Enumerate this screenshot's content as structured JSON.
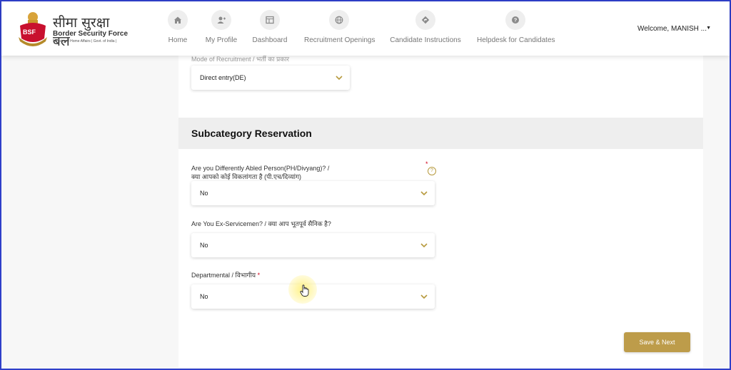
{
  "logo": {
    "hindi": "सीमा सुरक्षा बल",
    "english": "Border Security Force",
    "ministry": "Ministry of Home Affairs | Govt. of India |",
    "badge": "BSF"
  },
  "nav": [
    {
      "label": "Home",
      "icon": "home-icon"
    },
    {
      "label": "My Profile",
      "icon": "user-add-icon"
    },
    {
      "label": "Dashboard",
      "icon": "dashboard-icon"
    },
    {
      "label": "Recruitment Openings",
      "icon": "globe-icon"
    },
    {
      "label": "Candidate Instructions",
      "icon": "directions-icon"
    },
    {
      "label": "Helpdesk for Candidates",
      "icon": "help-icon"
    }
  ],
  "user": {
    "welcome": "Welcome, MANISH ..."
  },
  "form": {
    "mode_label_cut": "Mode of Recruitment / भर्ती का प्रकार",
    "mode_value": "Direct entry(DE)",
    "section_title": "Subcategory Reservation",
    "q1_label_en": "Are you Differently Abled Person(PH/Divyang)? /",
    "q1_label_hi": "क्या आपको कोई विकलांगता है (पी.एच/दिव्यांग)",
    "q1_value": "No",
    "q2_label": "Are You Ex-Servicemen? / क्या आप भूतपूर्व सैनिक है?",
    "q2_value": "No",
    "q3_label": "Departmental / विभागीय",
    "q3_value": "No",
    "required_mark": "*",
    "help_mark": "?"
  },
  "actions": {
    "save_next": "Save & Next"
  },
  "colors": {
    "accent": "#bd9c4a",
    "frame": "#2f3fc9",
    "section_band": "#eeeeee"
  }
}
